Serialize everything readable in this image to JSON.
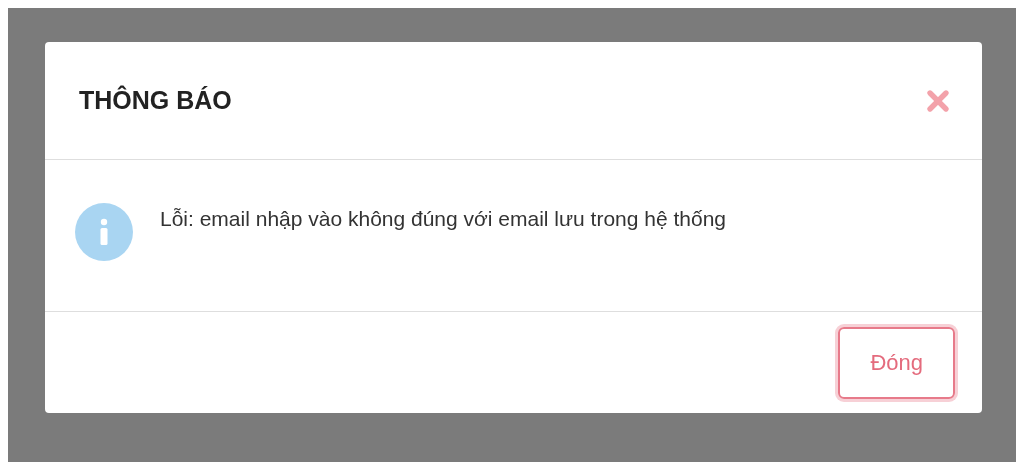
{
  "dialog": {
    "title": "THÔNG BÁO",
    "message": "Lỗi: email nhập vào không đúng với email lưu trong hệ thống",
    "buttons": [
      "Đóng"
    ]
  }
}
